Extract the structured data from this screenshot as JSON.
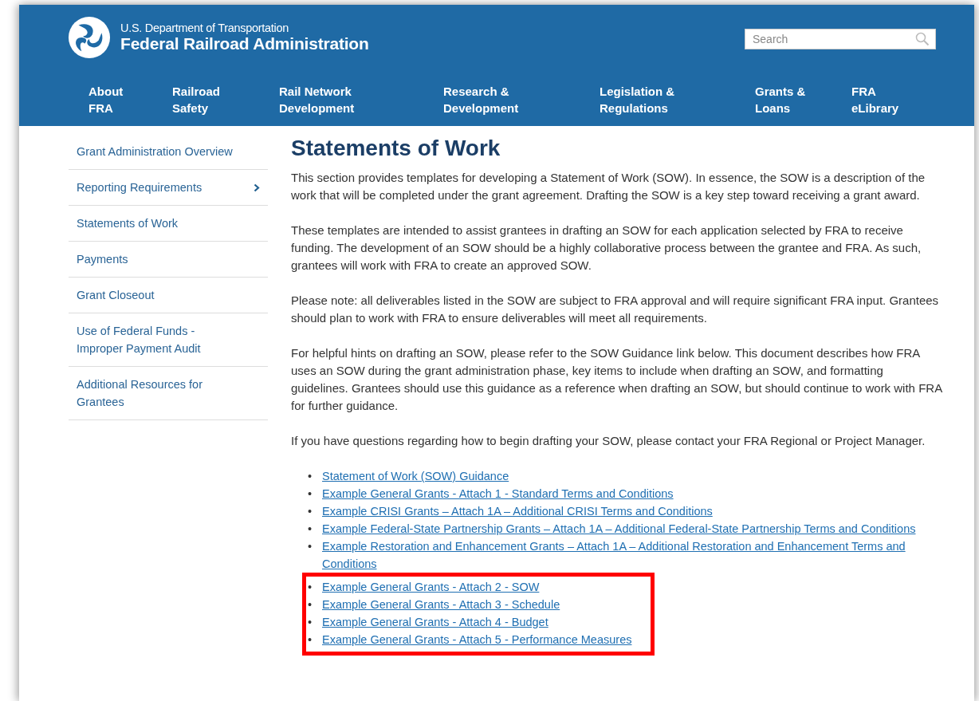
{
  "header": {
    "agency_line": "U.S. Department of Transportation",
    "title": "Federal Railroad Administration",
    "search": {
      "placeholder": "Search"
    }
  },
  "nav": [
    {
      "lines": [
        "About",
        "FRA"
      ]
    },
    {
      "lines": [
        "Railroad",
        "Safety"
      ]
    },
    {
      "lines": [
        "Rail Network",
        "Development"
      ]
    },
    {
      "lines": [
        "Research &",
        "Development"
      ]
    },
    {
      "lines": [
        "Legislation &",
        "Regulations"
      ]
    },
    {
      "lines": [
        "Grants &",
        "Loans"
      ]
    },
    {
      "lines": [
        "FRA",
        "eLibrary"
      ]
    }
  ],
  "sidebar": {
    "items": [
      {
        "label": "Grant Administration Overview",
        "expandable": false
      },
      {
        "label": "Reporting Requirements",
        "expandable": true
      },
      {
        "label": "Statements of Work",
        "expandable": false
      },
      {
        "label": "Payments",
        "expandable": false
      },
      {
        "label": "Grant Closeout",
        "expandable": false
      },
      {
        "label": "Use of Federal Funds - Improper Payment Audit",
        "expandable": false
      },
      {
        "label": "Additional Resources for Grantees",
        "expandable": false
      }
    ]
  },
  "content": {
    "heading": "Statements of Work",
    "paragraphs": [
      "This section provides templates for developing a Statement of Work (SOW). In essence, the SOW is a description of the work that will be completed under the grant agreement. Drafting the SOW is a key step toward receiving a grant award.",
      "These templates are intended to assist grantees in drafting an SOW for each application selected by FRA to receive funding. The development of an SOW should be a highly collaborative process between the grantee and FRA. As such, grantees will work with FRA to create an approved SOW.",
      "Please note:  all deliverables listed in the SOW are subject to FRA approval and will require significant FRA input. Grantees should plan to work with FRA to ensure deliverables will meet all requirements.",
      "For helpful hints on drafting an SOW, please refer to the SOW Guidance link below. This document describes how FRA uses an SOW during the grant administration phase, key items to include when drafting an SOW, and formatting guidelines. Grantees should use this guidance as a reference when drafting an SOW, but should continue to work with FRA for further guidance.",
      "If you have questions regarding how to begin drafting your SOW, please contact your FRA Regional or Project Manager."
    ],
    "links": [
      {
        "marker": "•",
        "label": "Statement of Work (SOW) Guidance",
        "highlighted": false
      },
      {
        "marker": "•",
        "label": "Example General Grants - Attach 1 - Standard Terms and Conditions",
        "highlighted": false
      },
      {
        "marker": "•",
        "label": "Example CRISI Grants – Attach 1A – Additional CRISI Terms and Conditions",
        "highlighted": false
      },
      {
        "marker": "•",
        "label": "Example Federal-State Partnership Grants – Attach 1A – Additional Federal-State Partnership Terms and Conditions",
        "highlighted": false
      },
      {
        "marker": "•",
        "label": "Example Restoration and Enhancement Grants – Attach 1A – Additional Restoration and Enhancement Terms and Conditions",
        "highlighted": false
      },
      {
        "marker": "•",
        "label": "Example General Grants - Attach 2 - SOW",
        "highlighted": true
      },
      {
        "marker": "•",
        "label": "Example General Grants - Attach 3 - Schedule",
        "highlighted": true
      },
      {
        "marker": "•",
        "label": "Example General Grants - Attach 4 - Budget",
        "highlighted": true
      },
      {
        "marker": "•",
        "label": "Example General Grants - Attach 5 - Performance Measures",
        "highlighted": true
      }
    ]
  }
}
